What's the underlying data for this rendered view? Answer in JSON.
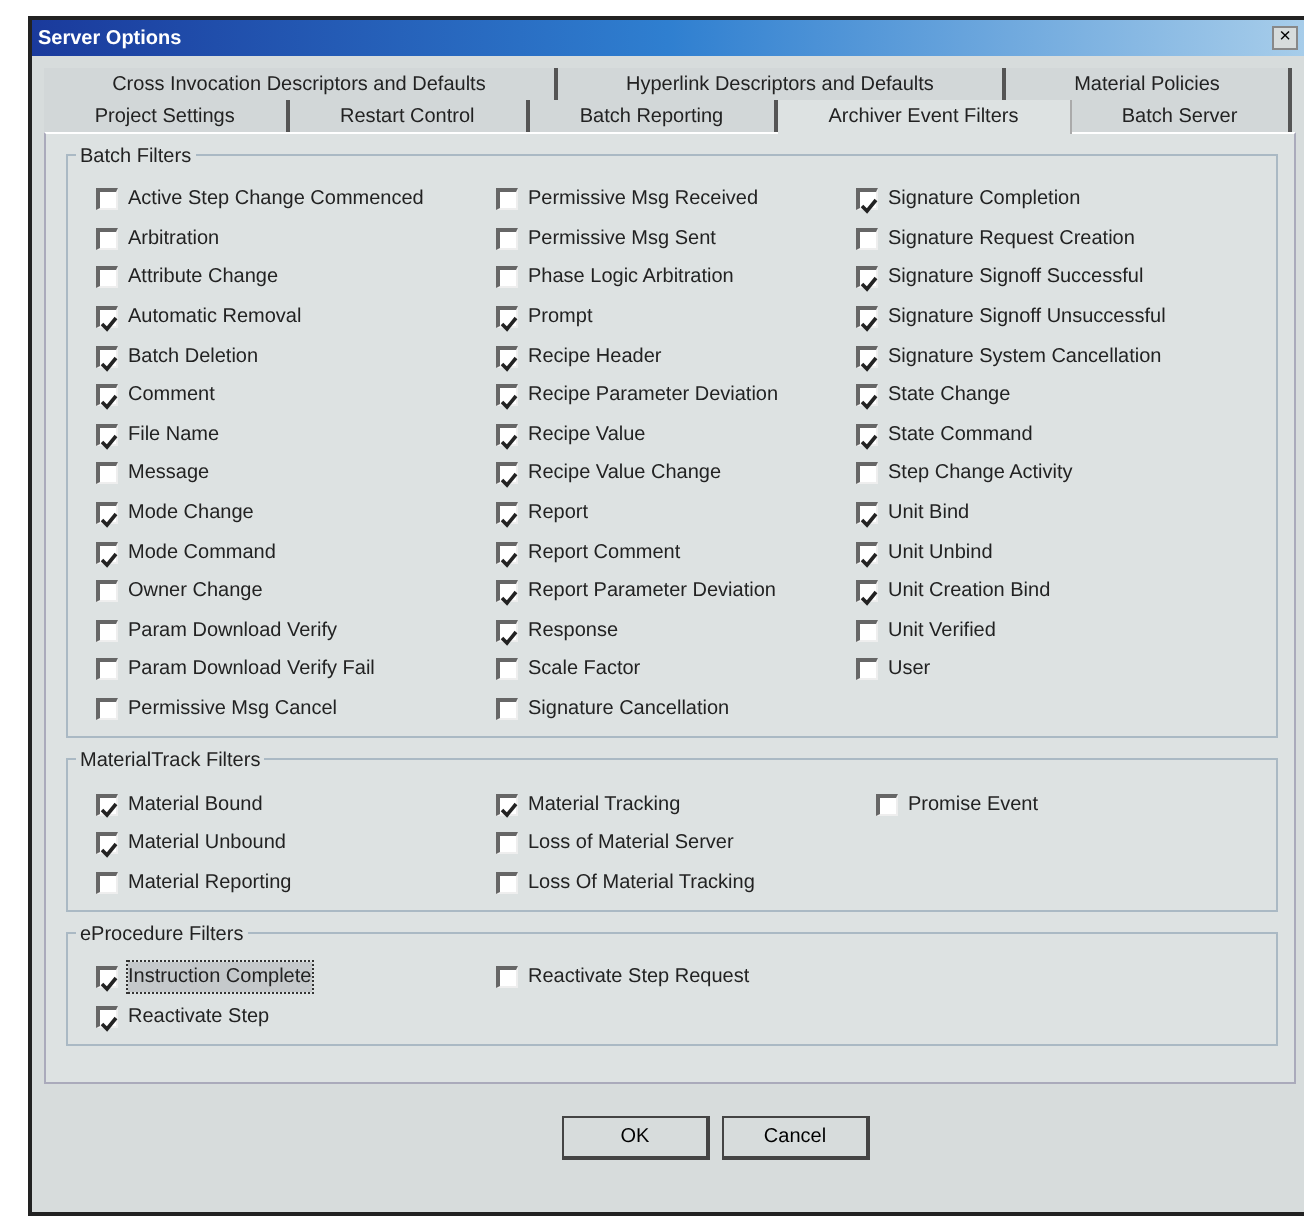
{
  "window": {
    "title": "Server Options",
    "close": "×"
  },
  "tab_rows": [
    {
      "tabs": [
        {
          "label": "Cross Invocation Descriptors and Defaults",
          "selected": false
        },
        {
          "label": "Hyperlink Descriptors and Defaults",
          "selected": false
        },
        {
          "label": "Material Policies",
          "selected": false
        }
      ]
    },
    {
      "tabs": [
        {
          "label": "Project Settings",
          "selected": false
        },
        {
          "label": "Restart Control",
          "selected": false
        },
        {
          "label": "Batch Reporting",
          "selected": false
        },
        {
          "label": "Archiver Event Filters",
          "selected": true
        },
        {
          "label": "Batch Server",
          "selected": false
        }
      ]
    }
  ],
  "groups": [
    {
      "title": "Batch Filters",
      "columns": [
        [
          {
            "label": "Active Step Change Commenced",
            "checked": false
          },
          {
            "label": "Arbitration",
            "checked": false
          },
          {
            "label": "Attribute Change",
            "checked": false
          },
          {
            "label": "Automatic Removal",
            "checked": true
          },
          {
            "label": "Batch Deletion",
            "checked": true
          },
          {
            "label": "Comment",
            "checked": true
          },
          {
            "label": "File Name",
            "checked": true
          },
          {
            "label": "Message",
            "checked": false
          },
          {
            "label": "Mode Change",
            "checked": true
          },
          {
            "label": "Mode Command",
            "checked": true
          },
          {
            "label": "Owner Change",
            "checked": false
          },
          {
            "label": "Param Download Verify",
            "checked": false
          },
          {
            "label": "Param Download Verify Fail",
            "checked": false
          },
          {
            "label": "Permissive Msg Cancel",
            "checked": false
          }
        ],
        [
          {
            "label": "Permissive Msg Received",
            "checked": false
          },
          {
            "label": "Permissive Msg Sent",
            "checked": false
          },
          {
            "label": "Phase Logic Arbitration",
            "checked": false
          },
          {
            "label": "Prompt",
            "checked": true
          },
          {
            "label": "Recipe Header",
            "checked": true
          },
          {
            "label": "Recipe Parameter Deviation",
            "checked": true
          },
          {
            "label": "Recipe Value",
            "checked": true
          },
          {
            "label": "Recipe Value Change",
            "checked": true
          },
          {
            "label": "Report",
            "checked": true
          },
          {
            "label": "Report Comment",
            "checked": true
          },
          {
            "label": "Report Parameter Deviation",
            "checked": true
          },
          {
            "label": "Response",
            "checked": true
          },
          {
            "label": "Scale Factor",
            "checked": false
          },
          {
            "label": "Signature Cancellation",
            "checked": false
          }
        ],
        [
          {
            "label": "Signature Completion",
            "checked": true
          },
          {
            "label": "Signature Request Creation",
            "checked": false
          },
          {
            "label": "Signature Signoff Successful",
            "checked": true
          },
          {
            "label": "Signature Signoff Unsuccessful",
            "checked": true
          },
          {
            "label": "Signature System Cancellation",
            "checked": true
          },
          {
            "label": "State Change",
            "checked": true
          },
          {
            "label": "State Command",
            "checked": true
          },
          {
            "label": "Step Change Activity",
            "checked": false
          },
          {
            "label": "Unit Bind",
            "checked": true
          },
          {
            "label": "Unit Unbind",
            "checked": true
          },
          {
            "label": "Unit Creation Bind",
            "checked": true
          },
          {
            "label": "Unit Verified",
            "checked": false
          },
          {
            "label": "User",
            "checked": false
          }
        ]
      ]
    },
    {
      "title": "MaterialTrack Filters",
      "columns": [
        [
          {
            "label": "Material Bound",
            "checked": true
          },
          {
            "label": "Material Unbound",
            "checked": true
          },
          {
            "label": "Material Reporting",
            "checked": false
          }
        ],
        [
          {
            "label": "Material Tracking",
            "checked": true
          },
          {
            "label": "Loss of Material Server",
            "checked": false
          },
          {
            "label": "Loss Of Material Tracking",
            "checked": false
          }
        ],
        [
          {
            "label": "Promise Event",
            "checked": false
          }
        ]
      ]
    },
    {
      "title": "eProcedure Filters",
      "columns": [
        [
          {
            "label": "Instruction Complete",
            "checked": true,
            "focused": true
          },
          {
            "label": "Reactivate Step",
            "checked": true,
            "focused": false
          }
        ],
        [
          {
            "label": "Reactivate Step Request",
            "checked": false,
            "focused": false
          }
        ]
      ]
    }
  ],
  "buttons": [
    "OK",
    "Cancel"
  ]
}
